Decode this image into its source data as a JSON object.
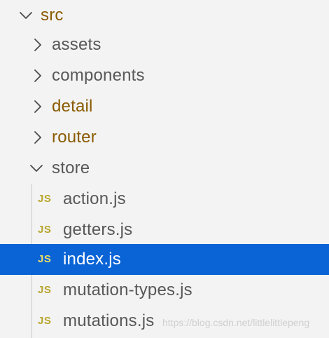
{
  "tree": {
    "root": {
      "label": "src",
      "expanded": true,
      "color": "#8a5a00"
    },
    "folders": [
      {
        "label": "assets",
        "expanded": false,
        "color": "#585858"
      },
      {
        "label": "components",
        "expanded": false,
        "color": "#585858"
      },
      {
        "label": "detail",
        "expanded": false,
        "color": "#8a5a00"
      },
      {
        "label": "router",
        "expanded": false,
        "color": "#8a5a00"
      },
      {
        "label": "store",
        "expanded": true,
        "color": "#585858"
      }
    ],
    "files": [
      {
        "icon": "JS",
        "label": "action.js",
        "selected": false
      },
      {
        "icon": "JS",
        "label": "getters.js",
        "selected": false
      },
      {
        "icon": "JS",
        "label": "index.js",
        "selected": true
      },
      {
        "icon": "JS",
        "label": "mutation-types.js",
        "selected": false
      },
      {
        "icon": "JS",
        "label": "mutations.js",
        "selected": false
      }
    ]
  },
  "watermark": "https://blog.csdn.net/littlelittlepeng",
  "colors": {
    "background": "#f3f3f3",
    "selection": "#0a64d6",
    "folder_modified": "#8a5a00",
    "folder_default": "#585858",
    "js_icon": "#b7a62e",
    "chevron": "#4a4a4a"
  }
}
